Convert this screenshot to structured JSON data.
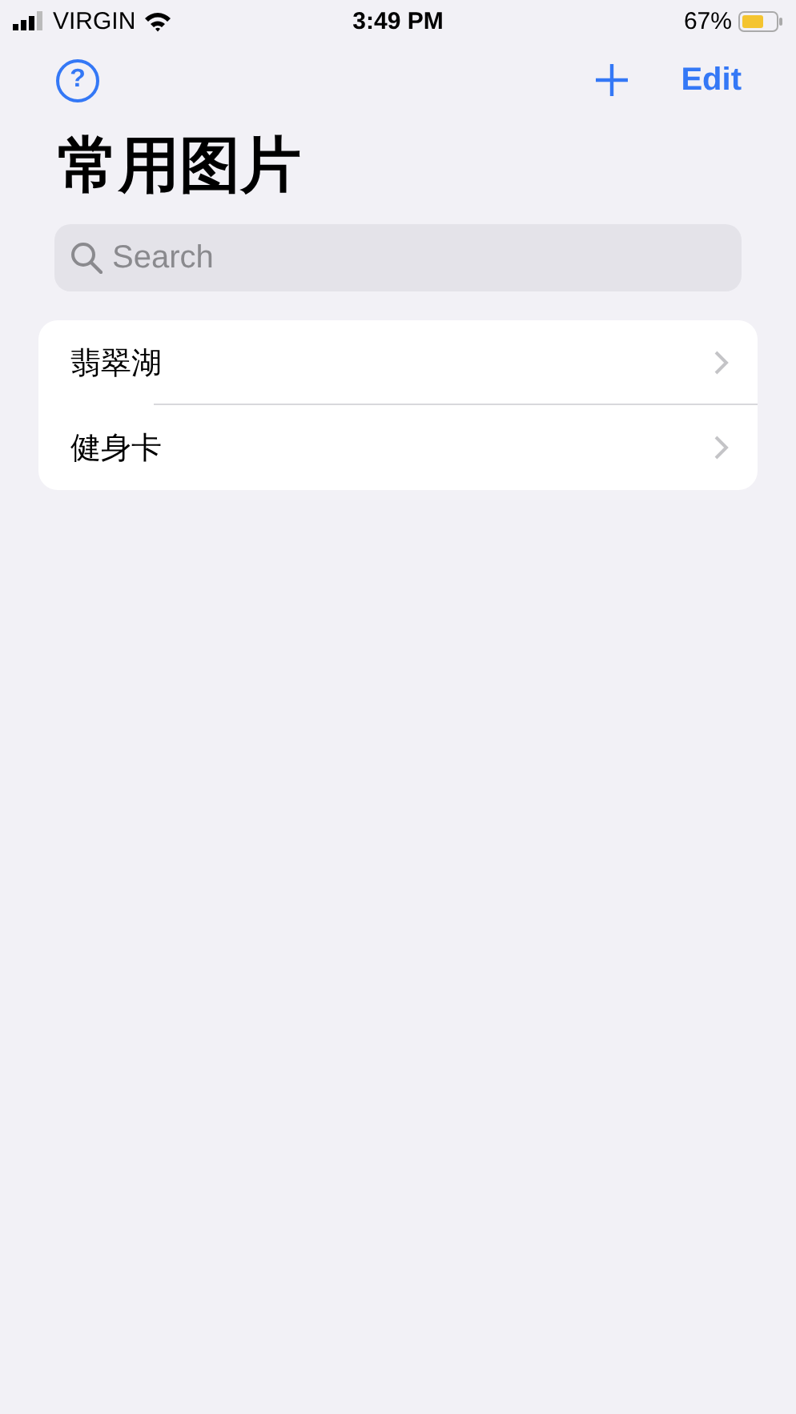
{
  "status_bar": {
    "carrier": "VIRGIN",
    "time": "3:49 PM",
    "battery": "67%"
  },
  "nav_bar": {
    "help_button": "?",
    "edit_button": "Edit"
  },
  "title": "常用图片",
  "search": {
    "placeholder": "Search"
  },
  "list": [
    {
      "label": "翡翠湖"
    },
    {
      "label": "健身卡"
    }
  ]
}
